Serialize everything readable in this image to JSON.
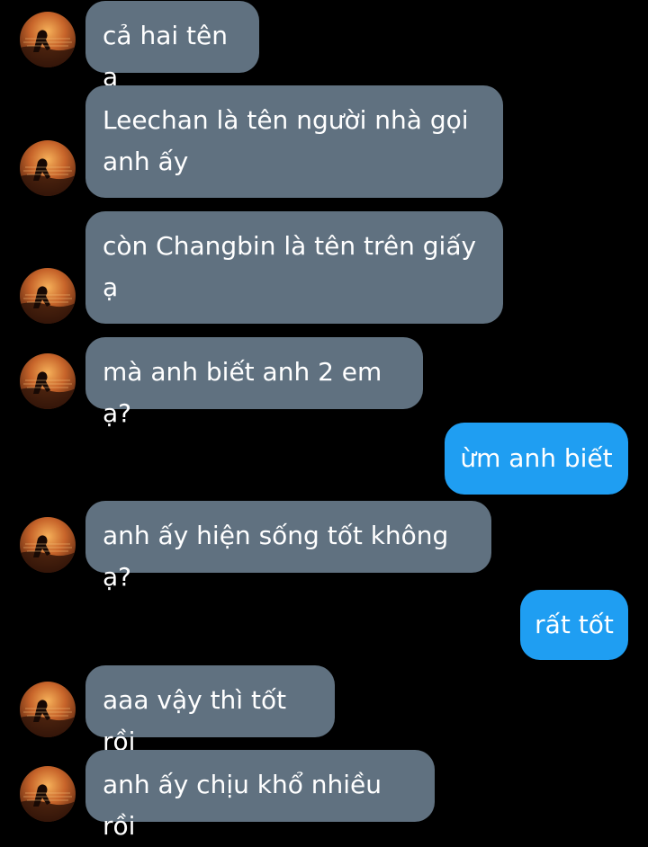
{
  "colors": {
    "background": "#000000",
    "incoming_bubble": "#607180",
    "outgoing_bubble": "#1f9ef2",
    "text": "#ffffff"
  },
  "avatar_icon": "sunset-silhouette-avatar",
  "messages": [
    {
      "side": "incoming",
      "text": "cả hai tên ạ"
    },
    {
      "side": "incoming",
      "text": "Leechan là tên người nhà gọi anh ấy"
    },
    {
      "side": "incoming",
      "text": "còn Changbin là tên trên giấy ạ"
    },
    {
      "side": "incoming",
      "text": "mà anh biết anh 2 em ạ?"
    },
    {
      "side": "outgoing",
      "text": "ừm anh biết"
    },
    {
      "side": "incoming",
      "text": "anh ấy hiện sống tốt không ạ?"
    },
    {
      "side": "outgoing",
      "text": "rất tốt"
    },
    {
      "side": "incoming",
      "text": "aaa vậy thì tốt rồi"
    },
    {
      "side": "incoming",
      "text": "anh ấy chịu khổ nhiều rồi"
    }
  ]
}
